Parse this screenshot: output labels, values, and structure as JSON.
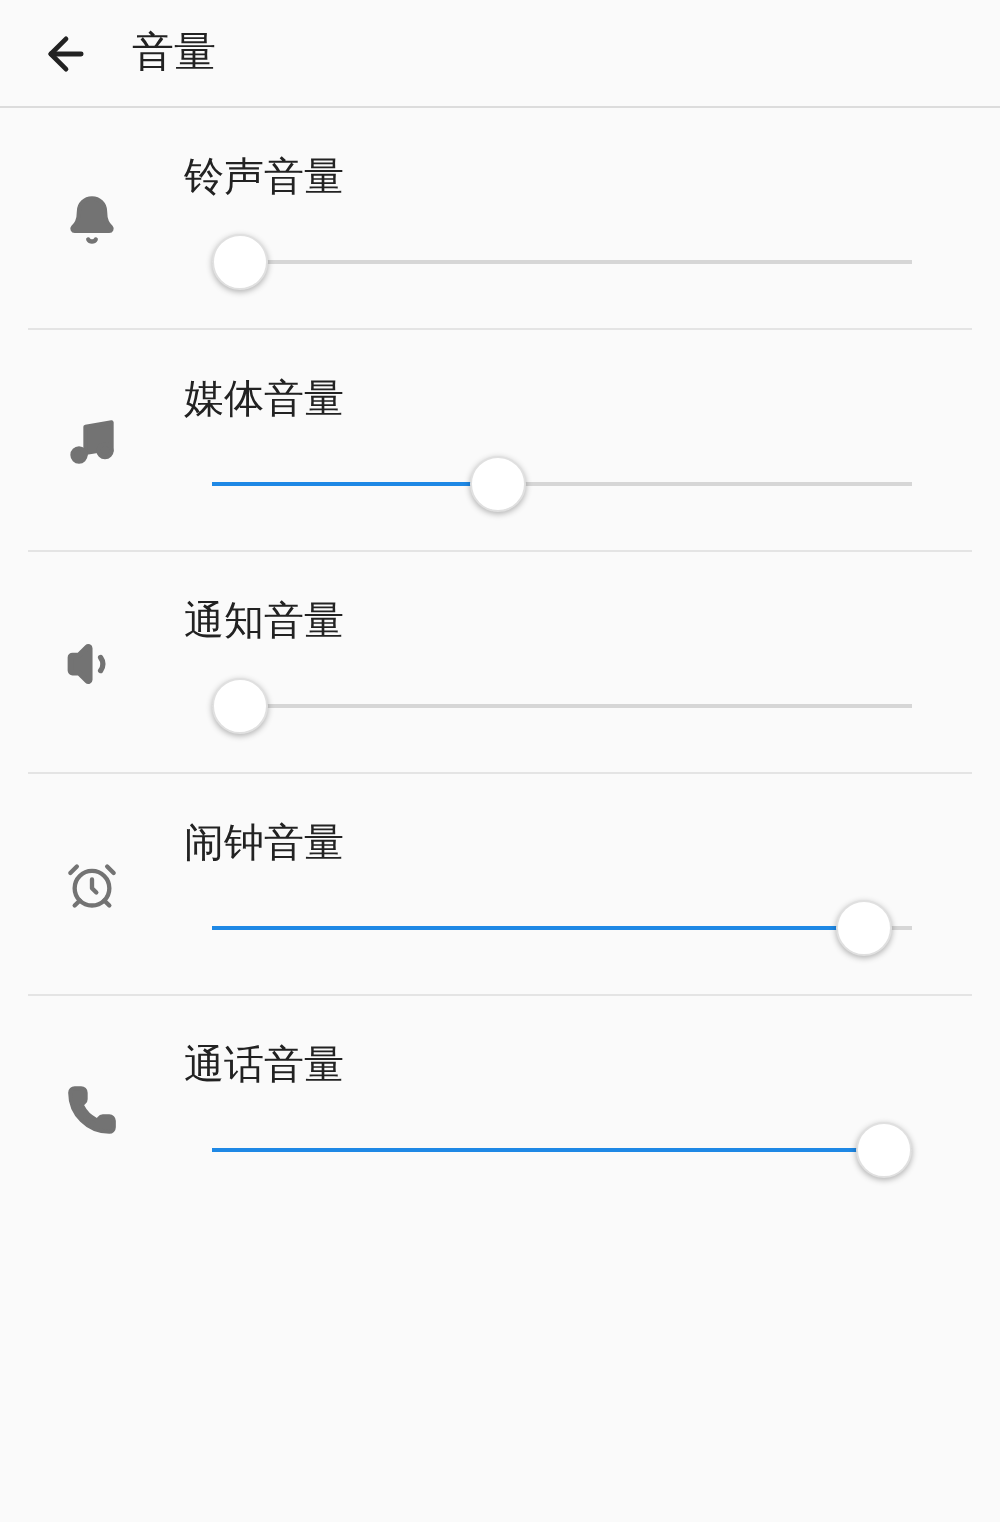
{
  "header": {
    "title": "音量"
  },
  "rows": [
    {
      "kind": "bell",
      "label": "铃声音量",
      "level": 0
    },
    {
      "kind": "music",
      "label": "媒体音量",
      "level": 0.4
    },
    {
      "kind": "speaker",
      "label": "通知音量",
      "level": 0
    },
    {
      "kind": "alarm",
      "label": "闹钟音量",
      "level": 0.97
    },
    {
      "kind": "phone",
      "label": "通话音量",
      "level": 1
    }
  ]
}
